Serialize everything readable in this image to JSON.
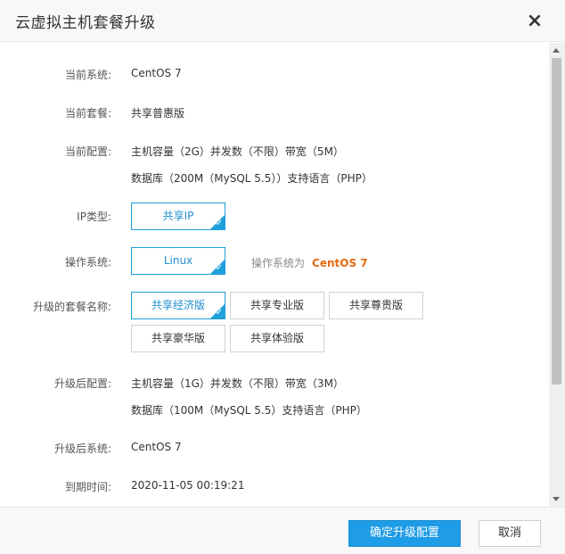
{
  "dialog": {
    "title": "云虚拟主机套餐升级",
    "close_icon": "close-icon",
    "close_glyph": "×"
  },
  "form": {
    "current_system": {
      "label": "当前系统:",
      "value": "CentOS 7"
    },
    "current_plan": {
      "label": "当前套餐:",
      "value": "共享普惠版"
    },
    "current_config": {
      "label": "当前配置:",
      "line1": "主机容量（2G）并发数（不限）带宽（5M）",
      "line2": "数据库（200M（MySQL 5.5））支持语言（PHP）"
    },
    "ip_type": {
      "label": "IP类型:",
      "options": [
        "共享IP"
      ],
      "selected": 0
    },
    "os": {
      "label": "操作系统:",
      "options": [
        "Linux"
      ],
      "selected": 0,
      "note_prefix": "操作系统为",
      "note_value": "CentOS 7"
    },
    "upgrade_plan": {
      "label": "升级的套餐名称:",
      "options": [
        "共享经济版",
        "共享专业版",
        "共享尊贵版",
        "共享豪华版",
        "共享体验版"
      ],
      "selected": 0
    },
    "new_config": {
      "label": "升级后配置:",
      "line1": "主机容量（1G）并发数（不限）带宽（3M）",
      "line2": "数据库（100M（MySQL 5.5）支持语言（PHP）"
    },
    "new_system": {
      "label": "升级后系统:",
      "value": "CentOS 7"
    },
    "expire": {
      "label": "到期时间:",
      "value": "2020-11-05 00:19:21"
    }
  },
  "footer": {
    "confirm_label": "确定升级配置",
    "cancel_label": "取消"
  },
  "colors": {
    "accent": "#1ea0dc",
    "primary_button": "#1e9ce6",
    "highlight": "#e86a10"
  }
}
